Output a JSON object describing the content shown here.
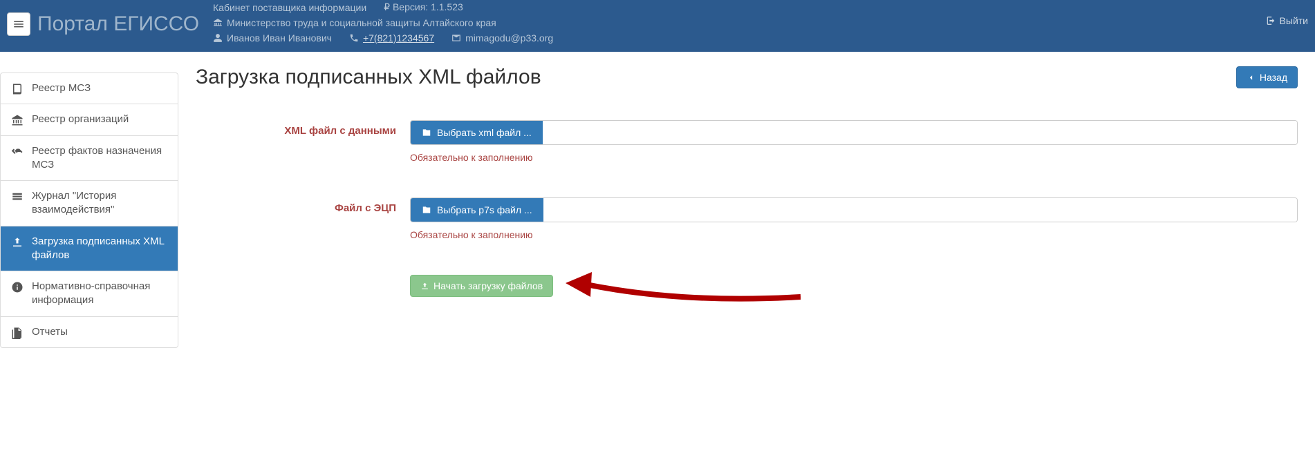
{
  "header": {
    "portal_title": "Портал ЕГИССО",
    "cabinet_label": "Кабинет поставщика информации",
    "version_label": "₽ Версия: 1.1.523",
    "ministry": "Министерство труда и социальной защиты Алтайского края",
    "user_name": "Иванов Иван Иванович",
    "phone": "+7(821)1234567",
    "email": "mimagodu@p33.org",
    "logout_label": "Выйти"
  },
  "sidebar": {
    "items": [
      {
        "label": "Реестр МСЗ"
      },
      {
        "label": "Реестр организаций"
      },
      {
        "label": "Реестр фактов назначения МСЗ"
      },
      {
        "label": "Журнал \"История взаимодействия\""
      },
      {
        "label": "Загрузка подписанных XML файлов"
      },
      {
        "label": "Нормативно-справочная информация"
      },
      {
        "label": "Отчеты"
      }
    ]
  },
  "page": {
    "title": "Загрузка подписанных XML файлов",
    "back_label": "Назад",
    "xml_label": "XML файл с данными",
    "xml_button": "Выбрать xml файл ...",
    "xml_help": "Обязательно к заполнению",
    "sig_label": "Файл с ЭЦП",
    "sig_button": "Выбрать p7s файл ...",
    "sig_help": "Обязательно к заполнению",
    "upload_button": "Начать загрузку файлов"
  }
}
